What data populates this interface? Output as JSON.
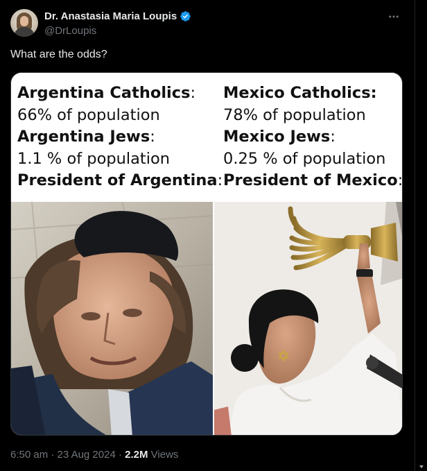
{
  "author": {
    "display_name": "Dr. Anastasia Maria Loupis",
    "handle": "@DrLoupis",
    "verified": true,
    "verified_color": "#1d9bf0"
  },
  "more_icon": "more-horizontal-icon",
  "tweet": {
    "text": "What are the odds?"
  },
  "media": {
    "left_column": {
      "heading1": "Argentina Catholics",
      "colon1": ":",
      "value1": "66% of population",
      "heading2": "Argentina Jews",
      "colon2": ":",
      "value2": "1.1 % of population",
      "heading3": "President of Argentina",
      "colon3": ":"
    },
    "right_column": {
      "heading1": "Mexico Catholics:",
      "value1": "78% of population",
      "heading2": "Mexico Jews",
      "colon2": ":",
      "value2": "0.25 % of population",
      "heading3": "President of Mexico",
      "colon3": ":"
    }
  },
  "footer": {
    "time": "6:50 am",
    "sep1": " · ",
    "date": "23 Aug 2024",
    "sep2": " · ",
    "views_count": "2.2M",
    "views_label": " Views"
  }
}
